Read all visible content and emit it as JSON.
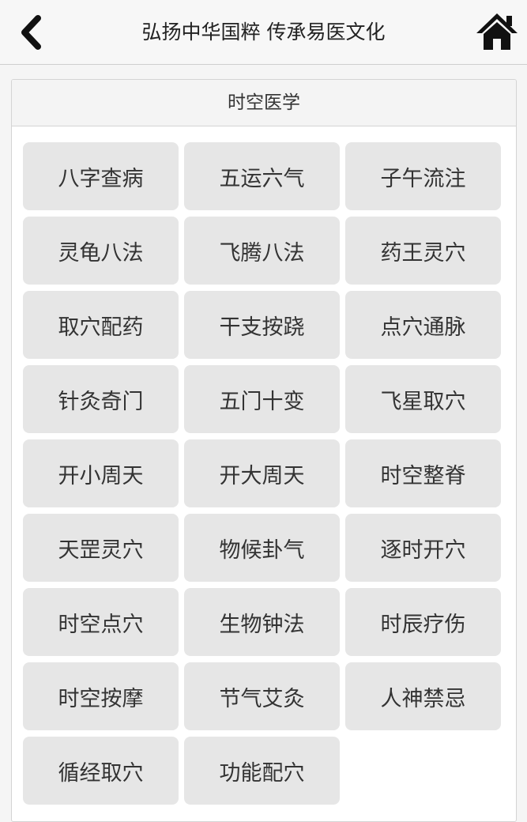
{
  "header": {
    "title": "弘扬中华国粹 传承易医文化",
    "back_icon": "chevron-left-icon",
    "home_icon": "home-icon"
  },
  "panel": {
    "title": "时空医学",
    "items": [
      "八字查病",
      "五运六气",
      "子午流注",
      "灵龟八法",
      "飞腾八法",
      "药王灵穴",
      "取穴配药",
      "干支按跷",
      "点穴通脉",
      "针灸奇门",
      "五门十变",
      "飞星取穴",
      "开小周天",
      "开大周天",
      "时空整脊",
      "天罡灵穴",
      "物候卦气",
      "逐时开穴",
      "时空点穴",
      "生物钟法",
      "时辰疗伤",
      "时空按摩",
      "节气艾灸",
      "人神禁忌",
      "循经取穴",
      "功能配穴"
    ]
  },
  "colors": {
    "button_bg": "#e6e6e6",
    "text": "#333333",
    "header_bg": "#f7f7f7"
  }
}
